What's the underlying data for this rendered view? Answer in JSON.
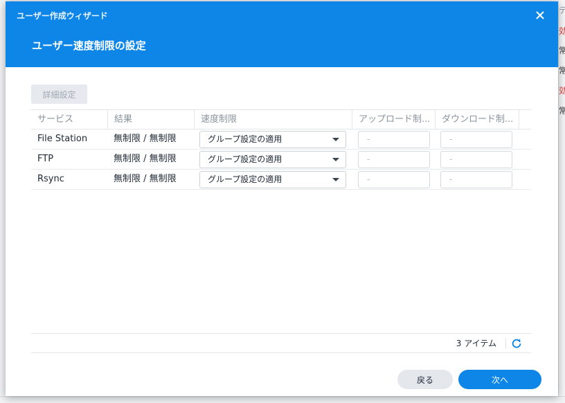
{
  "window": {
    "title": "ユーザー作成ウィザード",
    "page_title": "ユーザー速度制限の設定"
  },
  "toolbar": {
    "advanced_label": "詳細設定"
  },
  "table": {
    "headers": [
      "サービス",
      "結果",
      "速度制限",
      "アップロード制...",
      "ダウンロード制..."
    ],
    "rows": [
      {
        "service": "File Station",
        "result": "無制限 / 無制限",
        "limit": "グループ設定の適用",
        "upload": "-",
        "download": "-"
      },
      {
        "service": "FTP",
        "result": "無制限 / 無制限",
        "limit": "グループ設定の適用",
        "upload": "-",
        "download": "-"
      },
      {
        "service": "Rsync",
        "result": "無制限 / 無制限",
        "limit": "グループ設定の適用",
        "upload": "-",
        "download": "-"
      }
    ]
  },
  "footer": {
    "item_count": "3 アイテム"
  },
  "buttons": {
    "back": "戻る",
    "next": "次へ"
  },
  "background": {
    "right_fragments": [
      "テ",
      "効",
      "常",
      "常",
      "効",
      "常"
    ]
  },
  "colors": {
    "accent": "#0d86e8",
    "header_bg": "#0d86e8",
    "bg_red": "#d9322b"
  }
}
